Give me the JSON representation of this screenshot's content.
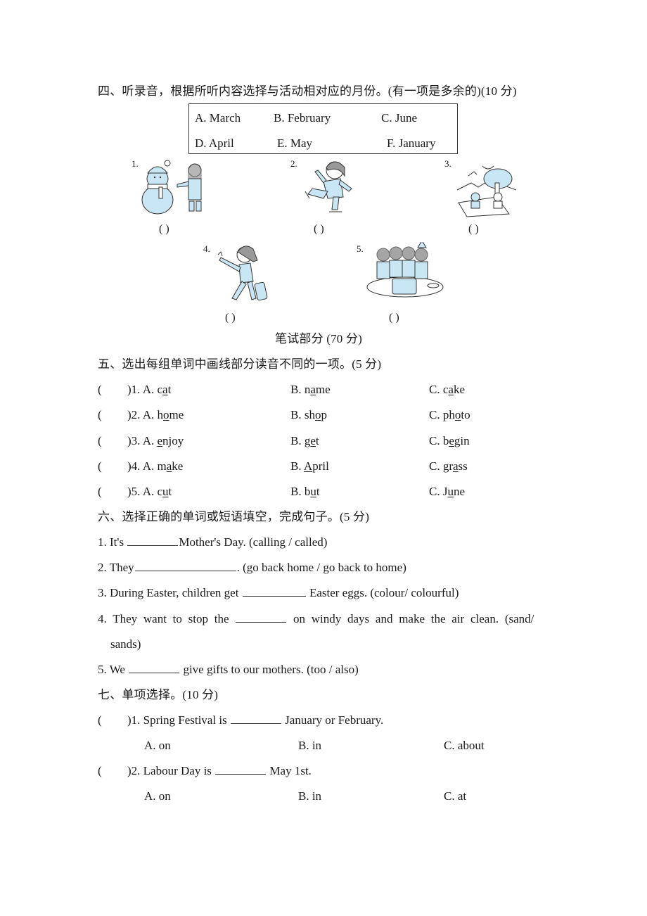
{
  "section4": {
    "title": "四、听录音，根据所听内容选择与活动相对应的月份。(有一项是多余的)(10 分)",
    "options": [
      {
        "label": "A. March"
      },
      {
        "label": "B. February"
      },
      {
        "label": "C. June"
      },
      {
        "label": "D. April"
      },
      {
        "label": "E. May"
      },
      {
        "label": "F. January"
      }
    ],
    "pictures": [
      {
        "num": "1.",
        "icon": "snowman-girl-picture",
        "answer": "(        )"
      },
      {
        "num": "2.",
        "icon": "ice-skating-girl-picture",
        "answer": "(        )"
      },
      {
        "num": "3.",
        "icon": "picnic-picture",
        "answer": "(        )"
      },
      {
        "num": "4.",
        "icon": "travelling-girl-picture",
        "answer": "(        )"
      },
      {
        "num": "5.",
        "icon": "birthday-party-picture",
        "answer": "(        )"
      }
    ]
  },
  "written_part": "笔试部分  (70 分)",
  "section5": {
    "title": "五、选出每组单词中画线部分读音不同的一项。(5 分)",
    "items": [
      {
        "paren": "(",
        "num": ")1. A. ",
        "a": [
          "c",
          "a",
          "t"
        ],
        "b": [
          "B. n",
          "a",
          "me"
        ],
        "c": [
          "C. c",
          "a",
          "ke"
        ]
      },
      {
        "paren": "(",
        "num": ")2. A. ",
        "a": [
          "h",
          "o",
          "me"
        ],
        "b": [
          "B. sh",
          "o",
          "p"
        ],
        "c": [
          "C. ph",
          "o",
          "to"
        ]
      },
      {
        "paren": "(",
        "num": ")3. A. ",
        "a": [
          "",
          "e",
          "njoy"
        ],
        "b": [
          "B. g",
          "e",
          "t"
        ],
        "c": [
          "C. b",
          "e",
          "gin"
        ]
      },
      {
        "paren": "(",
        "num": ")4. A. ",
        "a": [
          "m",
          "a",
          "ke"
        ],
        "b": [
          "B. ",
          "A",
          "pril"
        ],
        "c": [
          "C. gr",
          "a",
          "ss"
        ]
      },
      {
        "paren": "(",
        "num": ")5. A. ",
        "a": [
          "c",
          "u",
          "t"
        ],
        "b": [
          "B. b",
          "u",
          "t"
        ],
        "c": [
          "C. J",
          "u",
          "ne"
        ]
      }
    ]
  },
  "section6": {
    "title": "六、选择正确的单词或短语填空，完成句子。(5 分)",
    "items": [
      {
        "before": "1. It's ",
        "after": "Mother's Day. (calling / called)"
      },
      {
        "before": "2. They",
        "after": ". (go back home / go back to home)"
      },
      {
        "before": "3. During Easter, children get ",
        "after": " Easter eggs. (colour/ colourful)"
      },
      {
        "before": "4. They want to stop the ",
        "after": " on windy days and make the air clean. (sand/",
        "cont": "sands)"
      },
      {
        "before": "5. We ",
        "after": " give gifts to our mothers. (too / also)"
      }
    ]
  },
  "section7": {
    "title": "七、单项选择。(10 分)",
    "items": [
      {
        "paren": "(",
        "stem_before": ")1. Spring Festival is ",
        "stem_after": " January or February.",
        "options": [
          "A. on",
          "B. in",
          "C. about"
        ]
      },
      {
        "paren": "(",
        "stem_before": ")2. Labour Day is ",
        "stem_after": " May 1st.",
        "options": [
          "A. on",
          "B. in",
          "C. at"
        ]
      }
    ]
  },
  "colors": {
    "text": "#1a1a1a",
    "illustration_fill": "#c9e6f5",
    "illustration_line": "#333333"
  }
}
